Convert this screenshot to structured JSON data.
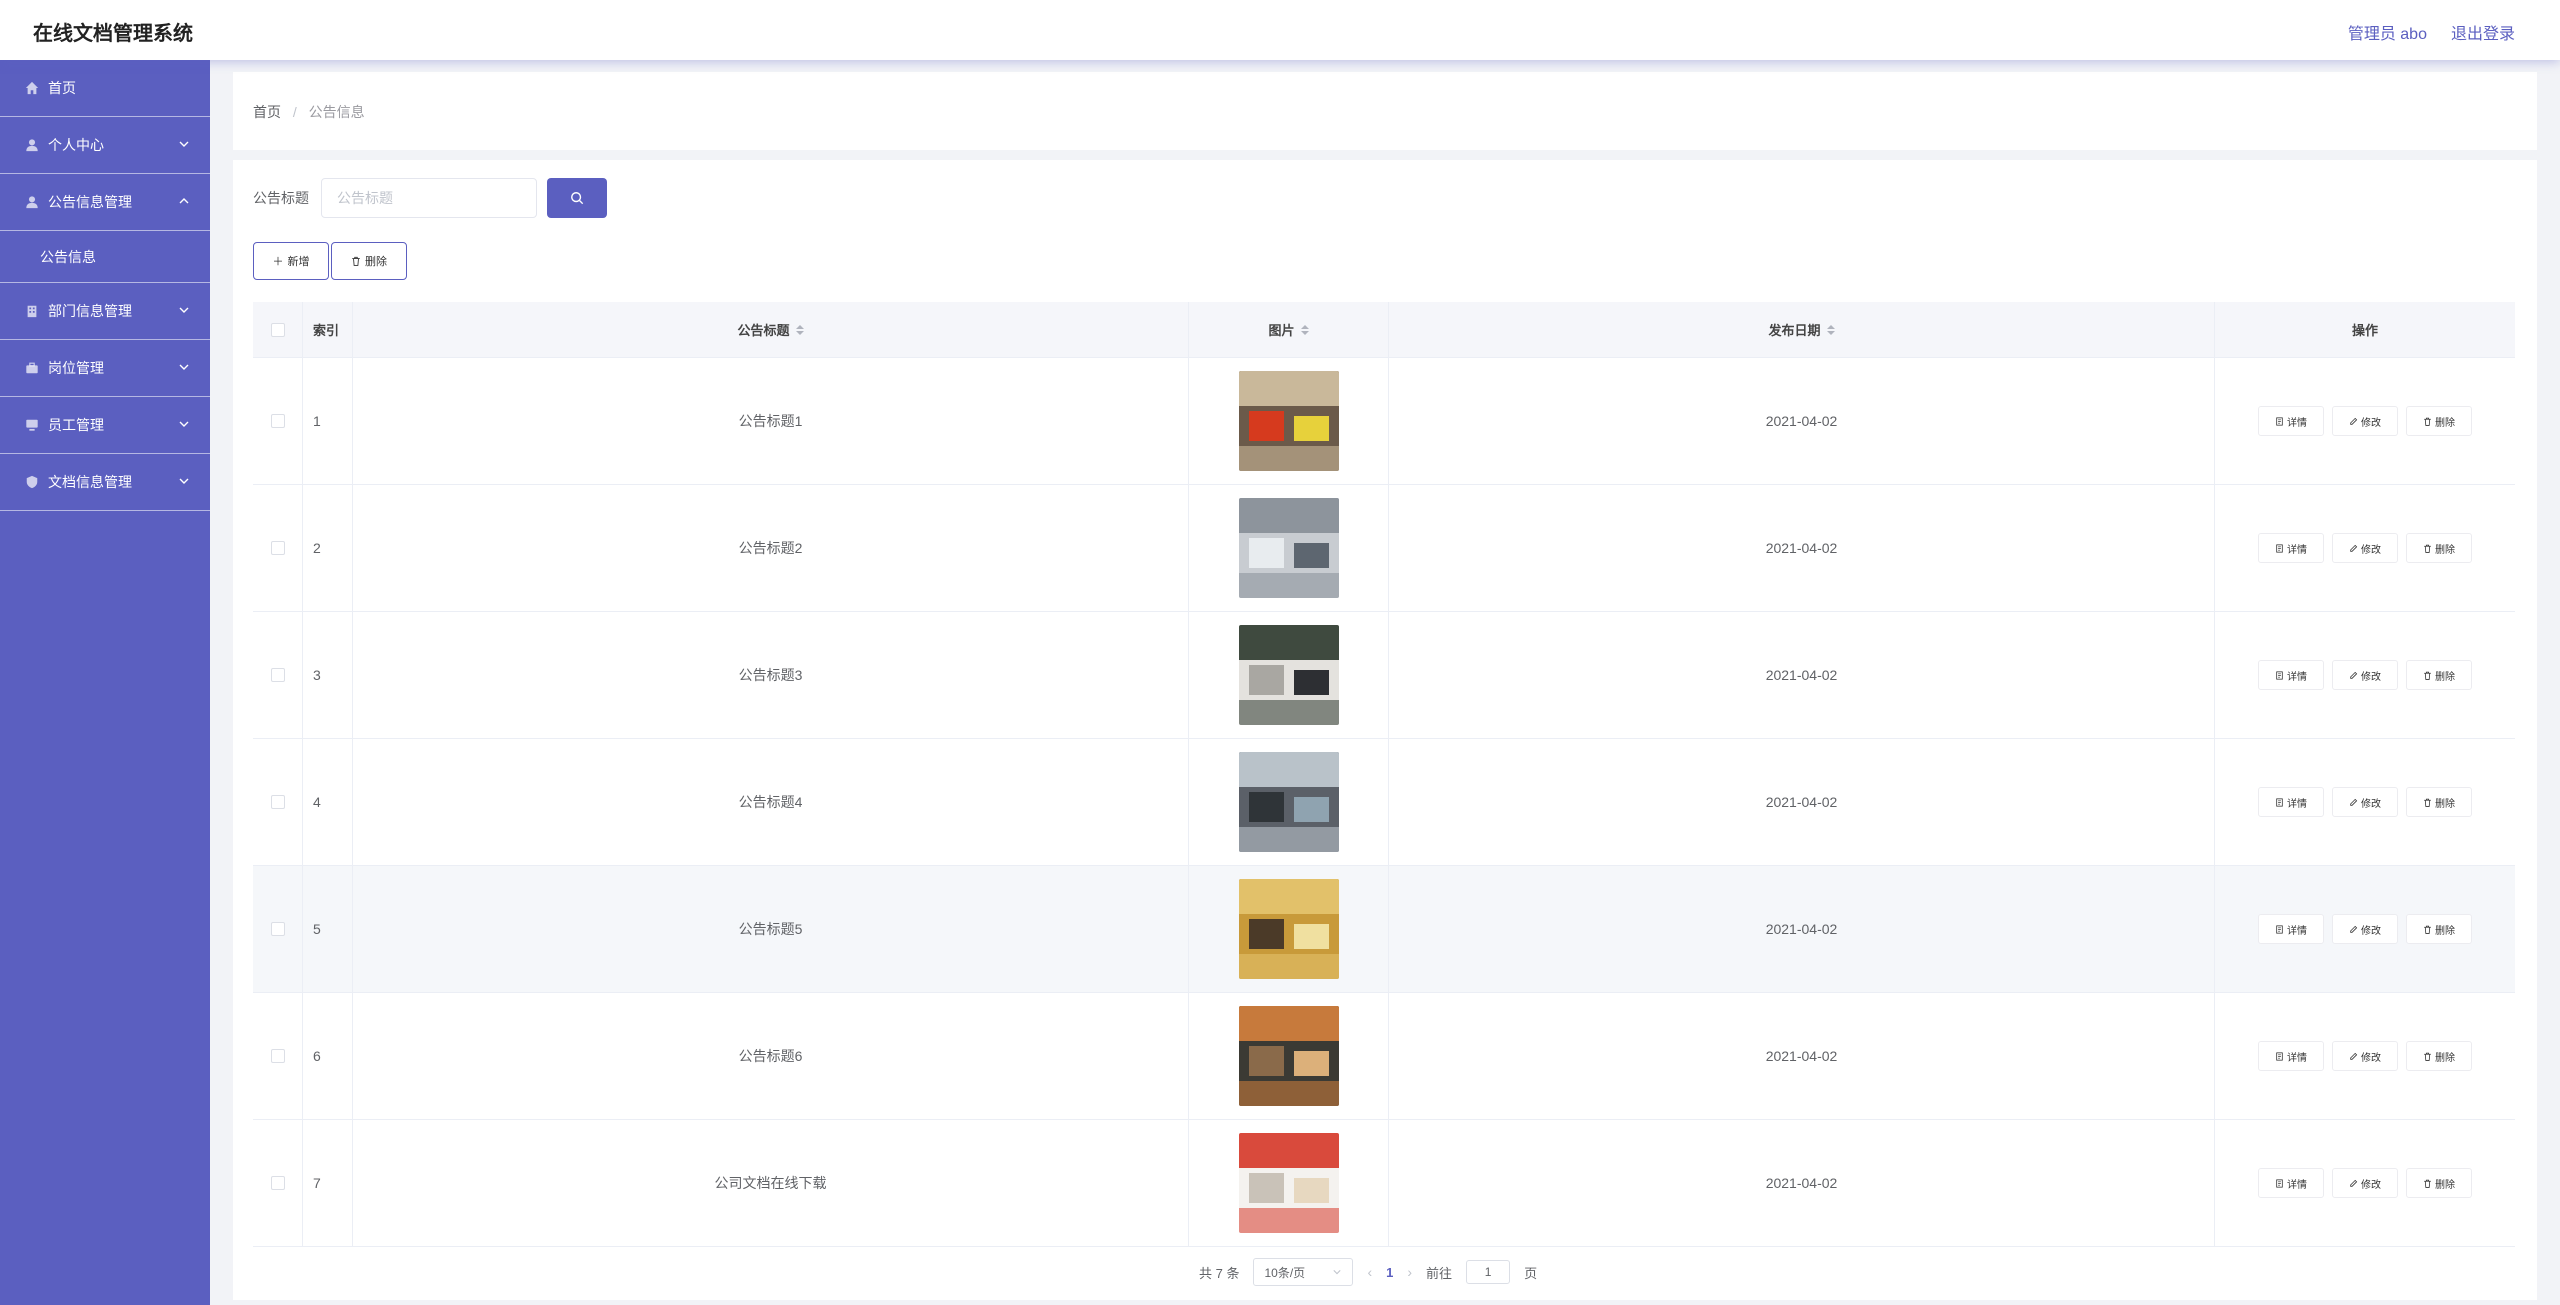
{
  "header": {
    "title": "在线文档管理系统",
    "user": "管理员 abo",
    "logout": "退出登录"
  },
  "sidebar": {
    "items": [
      {
        "label": "首页",
        "icon": "home-icon"
      },
      {
        "label": "个人中心",
        "icon": "user-icon",
        "expandable": true
      },
      {
        "label": "公告信息管理",
        "icon": "user-icon",
        "expandable": true,
        "expanded": true
      },
      {
        "label": "公告信息",
        "submenu": true
      },
      {
        "label": "部门信息管理",
        "icon": "building-icon",
        "expandable": true
      },
      {
        "label": "岗位管理",
        "icon": "briefcase-icon",
        "expandable": true
      },
      {
        "label": "员工管理",
        "icon": "monitor-icon",
        "expandable": true
      },
      {
        "label": "文档信息管理",
        "icon": "shield-icon",
        "expandable": true
      }
    ]
  },
  "breadcrumb": {
    "home": "首页",
    "separator": "/",
    "current": "公告信息"
  },
  "search": {
    "label": "公告标题",
    "placeholder": "公告标题"
  },
  "actions": {
    "add": "新增",
    "delete": "删除"
  },
  "table": {
    "columns": {
      "index": "索引",
      "title": "公告标题",
      "image": "图片",
      "date": "发布日期",
      "ops": "操作"
    },
    "op_labels": {
      "detail": "详情",
      "edit": "修改",
      "delete": "删除"
    },
    "rows": [
      {
        "index": "1",
        "title": "公告标题1",
        "date": "2021-04-02",
        "image": "office-photo-1"
      },
      {
        "index": "2",
        "title": "公告标题2",
        "date": "2021-04-02",
        "image": "office-photo-2"
      },
      {
        "index": "3",
        "title": "公告标题3",
        "date": "2021-04-02",
        "image": "office-photo-3"
      },
      {
        "index": "4",
        "title": "公告标题4",
        "date": "2021-04-02",
        "image": "office-photo-4"
      },
      {
        "index": "5",
        "title": "公告标题5",
        "date": "2021-04-02",
        "image": "office-photo-5"
      },
      {
        "index": "6",
        "title": "公告标题6",
        "date": "2021-04-02",
        "image": "office-photo-6"
      },
      {
        "index": "7",
        "title": "公司文档在线下载",
        "date": "2021-04-02",
        "image": "office-photo-7"
      }
    ]
  },
  "pagination": {
    "total": "共 7 条",
    "page_size": "10条/页",
    "current_page": "1",
    "goto_label": "前往",
    "goto_value": "1",
    "page_unit": "页"
  },
  "colors": {
    "accent": "#5b5fc0",
    "sidebar_bg": "#5b5fc0",
    "page_bg": "#f2f3f7"
  }
}
